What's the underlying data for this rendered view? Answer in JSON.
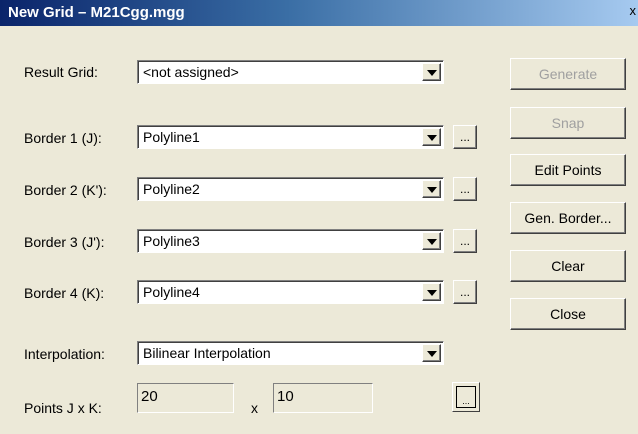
{
  "window": {
    "title": "New Grid – M21Cgg.mgg",
    "close_glyph": "x"
  },
  "result_grid": {
    "label": "Result Grid:",
    "value": "<not assigned>"
  },
  "borders": [
    {
      "label": "Border 1 (J):",
      "value": "Polyline1"
    },
    {
      "label": "Border 2 (K'):",
      "value": "Polyline2"
    },
    {
      "label": "Border 3 (J'):",
      "value": "Polyline3"
    },
    {
      "label": "Border 4 (K):",
      "value": "Polyline4"
    }
  ],
  "ellipsis": "...",
  "interpolation": {
    "label": "Interpolation:",
    "value": "Bilinear Interpolation"
  },
  "points": {
    "label": "Points J x K:",
    "j": "20",
    "x_label": "x",
    "k": "10"
  },
  "buttons": {
    "generate": "Generate",
    "snap": "Snap",
    "edit_points": "Edit Points",
    "gen_border": "Gen. Border...",
    "clear": "Clear",
    "close": "Close"
  }
}
